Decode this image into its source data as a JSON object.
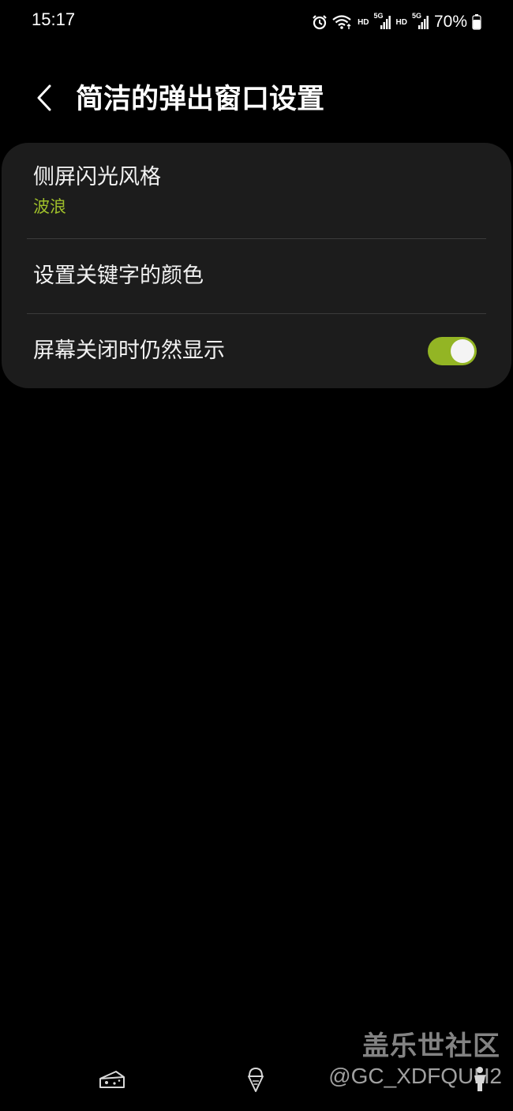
{
  "status_bar": {
    "time": "15:17",
    "hd_1": "HD",
    "hd_2": "HD",
    "network_1": "5G",
    "network_2": "5G",
    "battery_percent": "70%",
    "icons": [
      "alarm-icon",
      "wifi-icon",
      "signal-icon",
      "signal-icon",
      "battery-icon"
    ]
  },
  "header": {
    "back_icon": "chevron-left-icon",
    "title": "简洁的弹出窗口设置"
  },
  "settings": {
    "items": [
      {
        "title": "侧屏闪光风格",
        "subtitle": "波浪"
      },
      {
        "title": "设置关键字的颜色"
      },
      {
        "title": "屏幕关闭时仍然显示",
        "toggle_on": true
      }
    ]
  },
  "watermark": {
    "brand": "盖乐世社区",
    "user": "@GC_XDFQUH2"
  },
  "bottom_icons": [
    "cheese-icon",
    "ice-cream-icon",
    "person-icon"
  ],
  "colors": {
    "background": "#000000",
    "card": "#1c1c1c",
    "accent": "#9fbf2a",
    "toggle_track": "#93b524"
  }
}
